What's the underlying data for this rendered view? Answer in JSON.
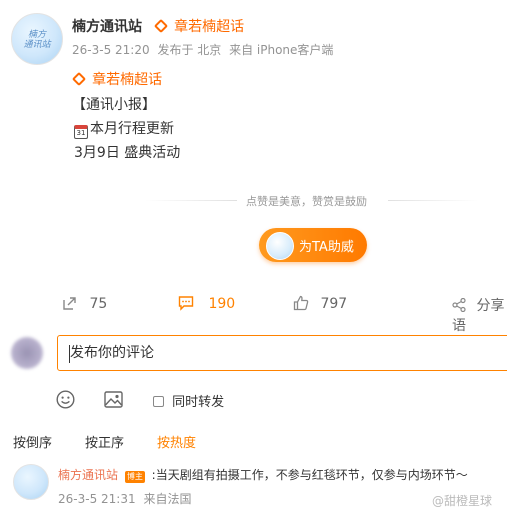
{
  "post": {
    "author": "楠方通讯站",
    "topic_header": "章若楠超话",
    "avatar_text_line1": "楠方",
    "avatar_text_line2": "通讯站",
    "time": "26-3-5 21:20",
    "location": "发布于 北京",
    "source": "来自 iPhone客户端",
    "topic_tag": "章若楠超话",
    "body": {
      "line1": "【通讯小报】",
      "calendar_glyph": "31",
      "line2": "本月行程更新",
      "line3": "3月9日 盛典活动"
    }
  },
  "reward": {
    "slogan": "点赞是美意，赞赏是鼓励",
    "button_label": "为TA助威"
  },
  "actions": {
    "share_count": "75",
    "comment_count": "190",
    "like_count": "797",
    "forward_label": "分享语"
  },
  "comment_input": {
    "placeholder": "发布你的评论",
    "forward_checkbox_label": "同时转发"
  },
  "sort_tabs": [
    {
      "label": "按倒序"
    },
    {
      "label": "按正序"
    },
    {
      "label": "按热度",
      "active": true
    }
  ],
  "comment": {
    "author": "楠方通讯站",
    "badge": "博主",
    "text": ":当天剧组有拍摄工作，不参与红毯环节，仅参与内场环节～",
    "time": "26-3-5 21:31",
    "source": "来自法国"
  },
  "watermark": "@甜橙星球",
  "colors": {
    "accent": "#ff8200",
    "topic": "#ff6a00",
    "meta": "#939393"
  }
}
